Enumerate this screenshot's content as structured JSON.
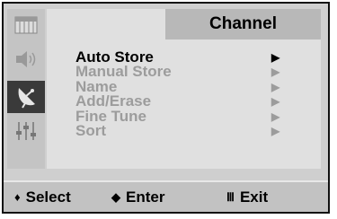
{
  "menu": {
    "title": "Channel",
    "items": [
      {
        "label": "Auto Store",
        "arrow": "▶",
        "selected": true
      },
      {
        "label": "Manual Store",
        "arrow": "▶",
        "selected": false
      },
      {
        "label": "Name",
        "arrow": "▶",
        "selected": false
      },
      {
        "label": "Add/Erase",
        "arrow": "▶",
        "selected": false
      },
      {
        "label": "Fine Tune",
        "arrow": "▶",
        "selected": false
      },
      {
        "label": "Sort",
        "arrow": "▶",
        "selected": false
      }
    ]
  },
  "sidebar": {
    "icons": [
      {
        "name": "picture-icon",
        "active": false
      },
      {
        "name": "sound-icon",
        "active": false
      },
      {
        "name": "channel-antenna-icon",
        "active": true
      },
      {
        "name": "setup-sliders-icon",
        "active": false
      }
    ]
  },
  "footer": {
    "select": {
      "glyph": "♦",
      "label": "Select"
    },
    "enter": {
      "glyph": "◆",
      "label": "Enter"
    },
    "exit": {
      "glyph": "Ⅲ",
      "label": "Exit"
    }
  },
  "colors": {
    "background": "#cfcfcf",
    "panel": "#e0e0e0",
    "title_bar": "#b8b8b8",
    "active_icon_bg": "#3a3a3a",
    "selected_text": "#000000",
    "disabled_text": "#9c9c9c"
  }
}
